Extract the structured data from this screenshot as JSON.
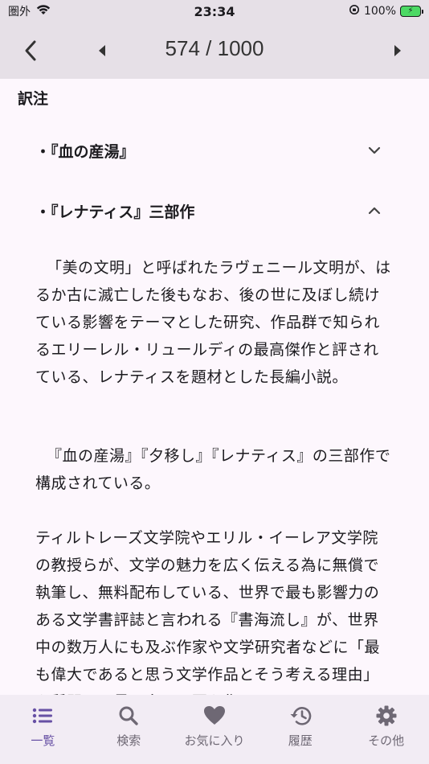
{
  "status_bar": {
    "carrier": "圏外",
    "time": "23:34",
    "battery": "100%"
  },
  "app_bar": {
    "page_current": "574",
    "page_separator": " / ",
    "page_total": "1000"
  },
  "content": {
    "section_title": "訳注",
    "accordions": [
      {
        "label": "・『血の産湯』",
        "expanded": false
      },
      {
        "label": "・『レナティス』三部作",
        "expanded": true
      }
    ],
    "paragraphs": [
      "「美の文明」と呼ばれたラヴェニール文明が、はるか古に滅亡した後もなお、後の世に及ぼし続けている影響をテーマとした研究、作品群で知られるエリーレル・リュールディの最高傑作と評されている、レナティスを題材とした長編小説。",
      "『血の産湯』『夕移し』『レナティス』の三部作で構成されている。",
      "ティルトレーズ文学院やエリル・イーレア文学院の教授らが、文学の魅力を広く伝える為に無償で執筆し、無料配布している、世界で最も影響力のある文学書評誌と言われる『書海流し』が、世界中の数万人にも及ぶ作家や文学研究者などに「最も偉大であると思う文学作品とそう考える理由」を質問し、最も多くの票を集めた"
    ]
  },
  "bottom_nav": {
    "items": [
      {
        "label": "一覧",
        "icon": "list-icon",
        "active": true
      },
      {
        "label": "検索",
        "icon": "search-icon",
        "active": false
      },
      {
        "label": "お気に入り",
        "icon": "heart-icon",
        "active": false
      },
      {
        "label": "履歴",
        "icon": "history-icon",
        "active": false
      },
      {
        "label": "その他",
        "icon": "gear-icon",
        "active": false
      }
    ]
  },
  "colors": {
    "accent": "#6750a4",
    "bar_background": "#e6e0e7",
    "content_background": "#fdf7fd",
    "inactive_icon": "#6e6874"
  }
}
